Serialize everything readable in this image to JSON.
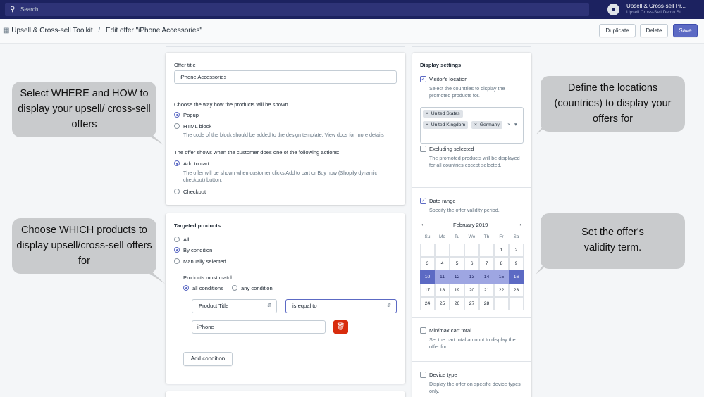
{
  "topbar": {
    "search_placeholder": "Search",
    "store_name": "Upsell & Cross-sell Pr...",
    "store_sub": "Upsell Cross-Sell Demo St..."
  },
  "breadcrumb": {
    "app": "Upsell & Cross-sell Toolkit",
    "separator": "/",
    "page": "Edit offer \"iPhone Accessories\""
  },
  "actions": {
    "duplicate": "Duplicate",
    "delete": "Delete",
    "save": "Save"
  },
  "offer": {
    "title_label": "Offer title",
    "title_value": "iPhone Accessories",
    "display_way_label": "Choose the way how the products will be shown",
    "popup": "Popup",
    "html_block": "HTML block",
    "html_help": "The code of the block should be added to the design template. View docs for more details",
    "trigger_label": "The offer shows when the customer does one of the following actions:",
    "add_to_cart": "Add to cart",
    "add_to_cart_help": "The offer will be shown when customer clicks Add to cart or Buy now (Shopify dynamic checkout) button.",
    "checkout": "Checkout"
  },
  "targeted": {
    "heading": "Targeted products",
    "all": "All",
    "by_condition": "By condition",
    "manually": "Manually selected",
    "must_match": "Products must match:",
    "all_conditions": "all conditions",
    "any_condition": "any condition",
    "field": "Product Title",
    "operator": "is equal to",
    "value": "iPhone",
    "add_condition": "Add condition"
  },
  "display": {
    "heading": "Display settings",
    "visitor_location": "Visitor's location",
    "visitor_help": "Select the countries to display the promoted products for.",
    "tags": [
      "United States",
      "United Kingdom",
      "Germany"
    ],
    "tag_remove": "×",
    "clear_icon": "×",
    "dropdown_icon": "▾",
    "excluding": "Excluding selected",
    "excluding_help": "The promoted products will be displayed for all countries except selected.",
    "date_range": "Date range",
    "date_help": "Specify the offer validity period.",
    "month": "February 2019",
    "prev": "←",
    "next": "→",
    "weekdays": [
      "Su",
      "Mo",
      "Tu",
      "We",
      "Th",
      "Fr",
      "Sa"
    ],
    "days": [
      "1",
      "2",
      "3",
      "4",
      "5",
      "6",
      "7",
      "8",
      "9",
      "10",
      "11",
      "12",
      "13",
      "14",
      "15",
      "16",
      "17",
      "18",
      "19",
      "20",
      "21",
      "22",
      "23",
      "24",
      "25",
      "26",
      "27",
      "28"
    ],
    "cart_total": "Min/max cart total",
    "cart_help": "Set the cart total amount to display the offer for.",
    "device": "Device type",
    "device_help": "Display the offer on specific device types only."
  },
  "callouts": {
    "where_how": "Select WHERE and HOW to display your upsell/ cross-sell offers",
    "which": "Choose WHICH products to display upsell/cross-sell offers for",
    "locations": "Define the locations (countries) to display your offers for",
    "validity": "Set the offer's validity term."
  },
  "colors": {
    "topbar": "#1c2260",
    "accent": "#5c6ac4",
    "danger": "#d82c0d",
    "callout": "#c9cbcd"
  }
}
